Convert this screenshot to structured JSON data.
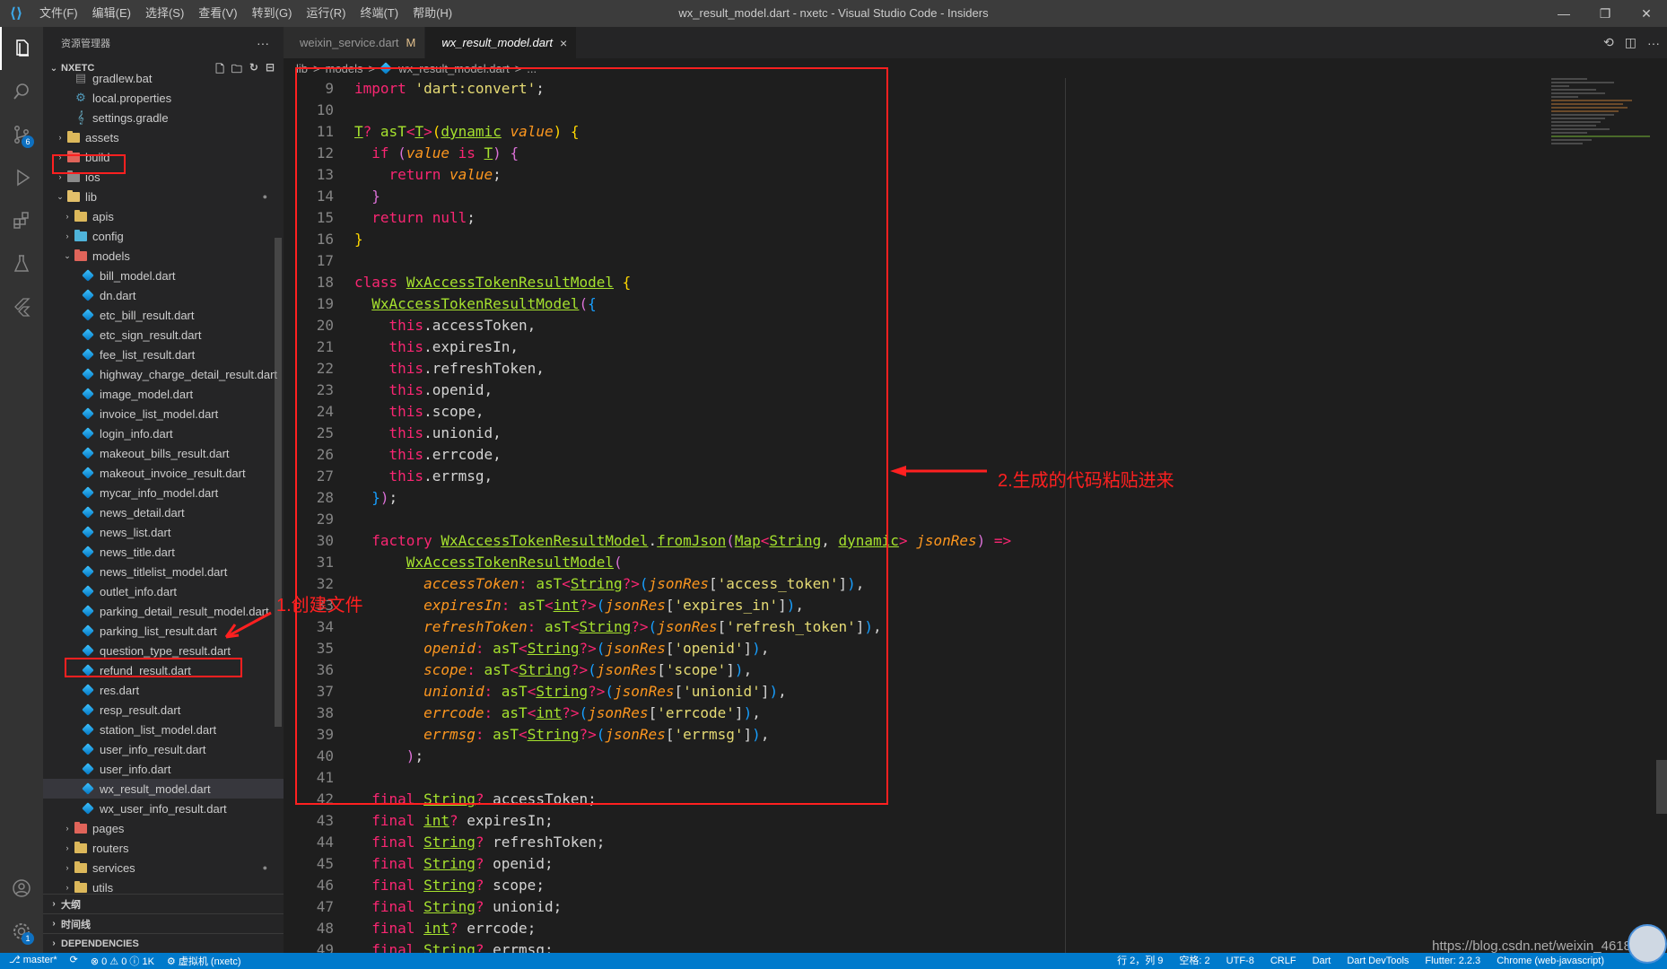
{
  "titlebar": {
    "menus": [
      "文件(F)",
      "编辑(E)",
      "选择(S)",
      "查看(V)",
      "转到(G)",
      "运行(R)",
      "终端(T)",
      "帮助(H)"
    ],
    "title": "wx_result_model.dart - nxetc - Visual Studio Code - Insiders"
  },
  "activity": {
    "scm_badge": "6",
    "settings_badge": "1"
  },
  "sidebar": {
    "header": "资源管理器",
    "section": "NXETC",
    "tree": [
      {
        "label": "gradlew.bat",
        "kind": "file-gray",
        "indent": 2
      },
      {
        "label": "local.properties",
        "kind": "gear",
        "indent": 2
      },
      {
        "label": "settings.gradle",
        "kind": "gradle",
        "indent": 2
      },
      {
        "label": "assets",
        "kind": "folder-yellow",
        "indent": 1,
        "chev": "›"
      },
      {
        "label": "build",
        "kind": "folder-red",
        "indent": 1,
        "chev": "›"
      },
      {
        "label": "ios",
        "kind": "folder-gray",
        "indent": 1,
        "chev": "›"
      },
      {
        "label": "lib",
        "kind": "folder-open",
        "indent": 1,
        "chev": "⌄",
        "dot": true
      },
      {
        "label": "apis",
        "kind": "folder-yellow",
        "indent": 2,
        "chev": "›"
      },
      {
        "label": "config",
        "kind": "folder-cyan",
        "indent": 2,
        "chev": "›"
      },
      {
        "label": "models",
        "kind": "folder-red",
        "indent": 2,
        "chev": "⌄"
      },
      {
        "label": "bill_model.dart",
        "kind": "dart",
        "indent": 3
      },
      {
        "label": "dn.dart",
        "kind": "dart",
        "indent": 3
      },
      {
        "label": "etc_bill_result.dart",
        "kind": "dart",
        "indent": 3
      },
      {
        "label": "etc_sign_result.dart",
        "kind": "dart",
        "indent": 3
      },
      {
        "label": "fee_list_result.dart",
        "kind": "dart",
        "indent": 3
      },
      {
        "label": "highway_charge_detail_result.dart",
        "kind": "dart",
        "indent": 3
      },
      {
        "label": "image_model.dart",
        "kind": "dart",
        "indent": 3
      },
      {
        "label": "invoice_list_model.dart",
        "kind": "dart",
        "indent": 3
      },
      {
        "label": "login_info.dart",
        "kind": "dart",
        "indent": 3
      },
      {
        "label": "makeout_bills_result.dart",
        "kind": "dart",
        "indent": 3
      },
      {
        "label": "makeout_invoice_result.dart",
        "kind": "dart",
        "indent": 3
      },
      {
        "label": "mycar_info_model.dart",
        "kind": "dart",
        "indent": 3
      },
      {
        "label": "news_detail.dart",
        "kind": "dart",
        "indent": 3
      },
      {
        "label": "news_list.dart",
        "kind": "dart",
        "indent": 3
      },
      {
        "label": "news_title.dart",
        "kind": "dart",
        "indent": 3
      },
      {
        "label": "news_titlelist_model.dart",
        "kind": "dart",
        "indent": 3
      },
      {
        "label": "outlet_info.dart",
        "kind": "dart",
        "indent": 3
      },
      {
        "label": "parking_detail_result_model.dart",
        "kind": "dart",
        "indent": 3
      },
      {
        "label": "parking_list_result.dart",
        "kind": "dart",
        "indent": 3
      },
      {
        "label": "question_type_result.dart",
        "kind": "dart",
        "indent": 3
      },
      {
        "label": "refund_result.dart",
        "kind": "dart",
        "indent": 3
      },
      {
        "label": "res.dart",
        "kind": "dart",
        "indent": 3
      },
      {
        "label": "resp_result.dart",
        "kind": "dart",
        "indent": 3
      },
      {
        "label": "station_list_model.dart",
        "kind": "dart",
        "indent": 3
      },
      {
        "label": "user_info_result.dart",
        "kind": "dart",
        "indent": 3
      },
      {
        "label": "user_info.dart",
        "kind": "dart",
        "indent": 3
      },
      {
        "label": "wx_result_model.dart",
        "kind": "dart",
        "indent": 3,
        "selected": true
      },
      {
        "label": "wx_user_info_result.dart",
        "kind": "dart",
        "indent": 3
      },
      {
        "label": "pages",
        "kind": "folder-red",
        "indent": 2,
        "chev": "›"
      },
      {
        "label": "routers",
        "kind": "folder-yellow",
        "indent": 2,
        "chev": "›"
      },
      {
        "label": "services",
        "kind": "folder-yellow",
        "indent": 2,
        "chev": "›",
        "dot": true
      },
      {
        "label": "utils",
        "kind": "folder-yellow",
        "indent": 2,
        "chev": "›"
      }
    ],
    "bottom_sections": [
      "大纲",
      "时间线",
      "DEPENDENCIES"
    ]
  },
  "tabs": [
    {
      "label": "weixin_service.dart",
      "modified": "M"
    },
    {
      "label": "wx_result_model.dart",
      "close": "×"
    }
  ],
  "breadcrumb": [
    "lib",
    ">",
    "models",
    ">",
    "wx_result_model.dart",
    ">",
    "..."
  ],
  "editor": {
    "line_numbers": [
      "9",
      "10",
      "11",
      "12",
      "13",
      "14",
      "15",
      "16",
      "17",
      "18",
      "19",
      "20",
      "21",
      "22",
      "23",
      "24",
      "25",
      "26",
      "27",
      "28",
      "29",
      "30",
      "31",
      "32",
      "33",
      "34",
      "35",
      "36",
      "37",
      "38",
      "39",
      "40",
      "41",
      "42",
      "43",
      "44",
      "45",
      "46",
      "47",
      "48",
      "49"
    ]
  },
  "annotations": {
    "step1": "1.创建文件",
    "step2": "2.生成的代码粘贴进来"
  },
  "statusbar": {
    "branch": "master*",
    "sync": "⟳",
    "problems": "⊗ 0 ⚠ 0 ⓘ 1K",
    "vm": "虚拟机 (nxetc)",
    "position": "行 2，列 9",
    "spaces": "空格: 2",
    "encoding": "UTF-8",
    "eol": "CRLF",
    "language": "Dart",
    "devtools": "Dart DevTools",
    "flutter": "Flutter: 2.2.3",
    "device": "Chrome (web-javascript)"
  },
  "watermark": "https://blog.csdn.net/weixin_4618",
  "colors": {
    "accent": "#007acc",
    "annotation": "#ff2020",
    "dart": "#0175c2"
  }
}
